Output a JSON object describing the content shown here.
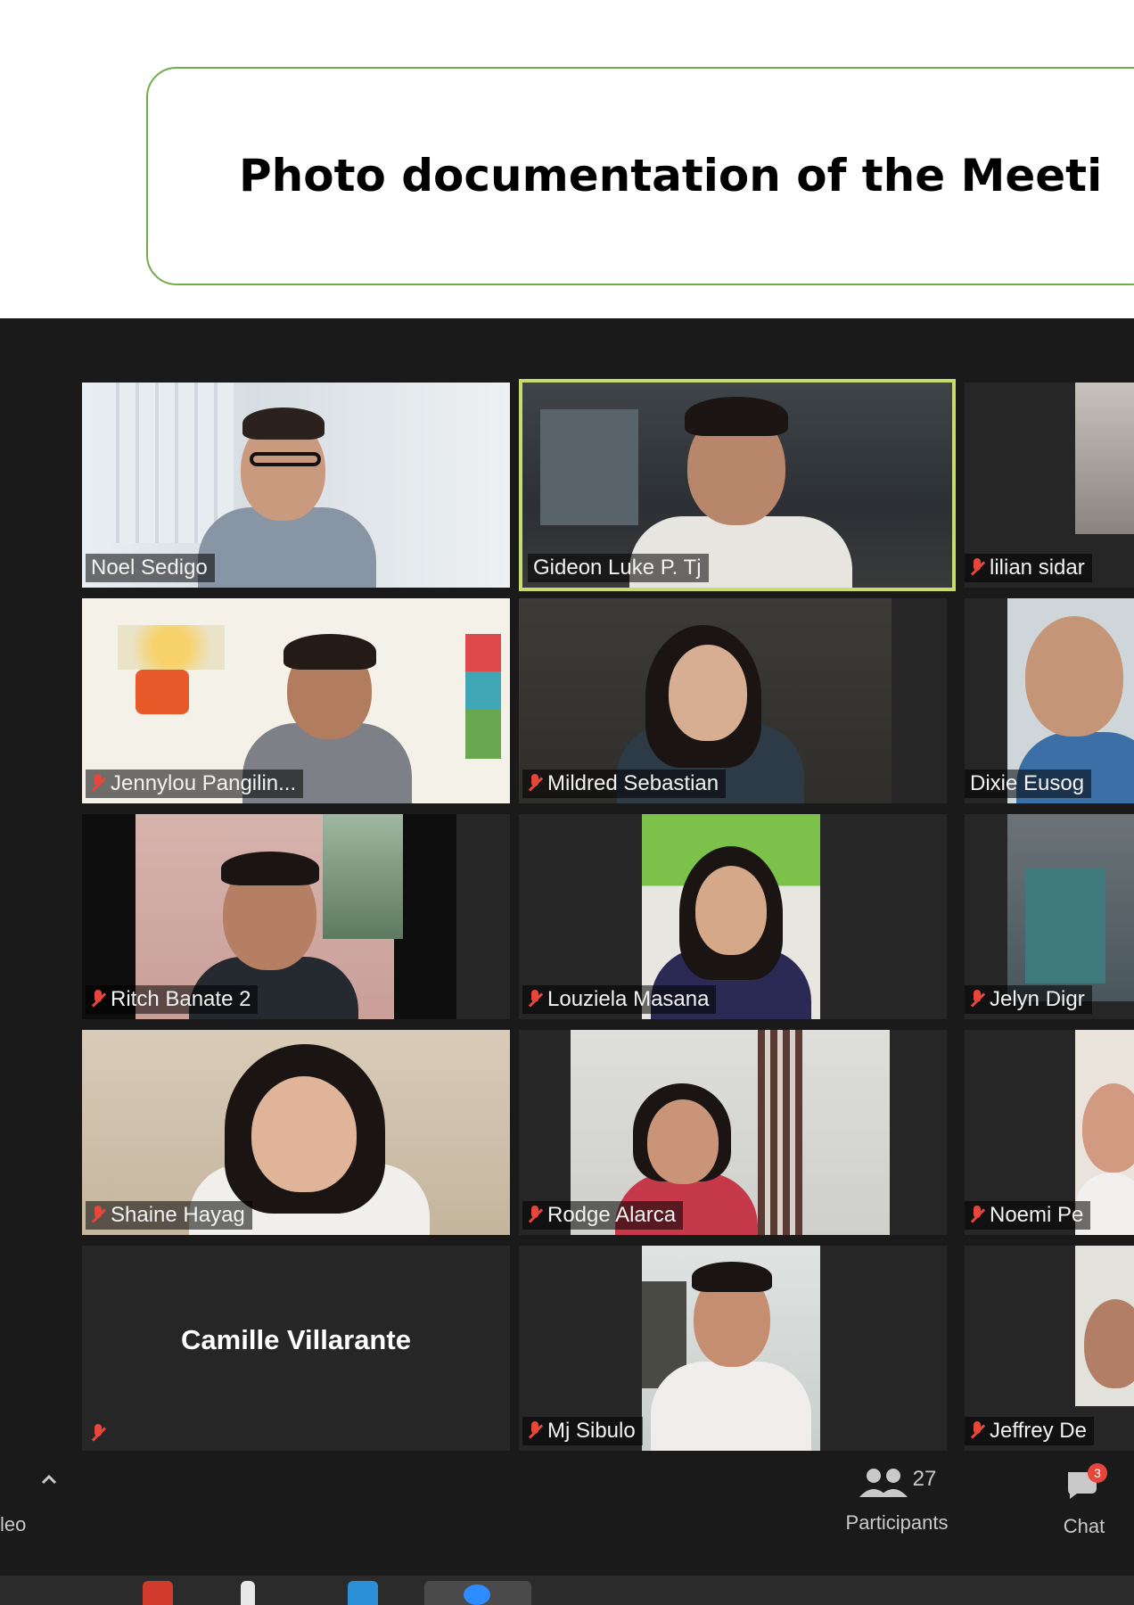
{
  "header": {
    "title": "Photo documentation of the Meeti"
  },
  "participants": [
    {
      "name": "Noel Sedigo",
      "muted": false,
      "active": false
    },
    {
      "name": "Gideon Luke P. Tj",
      "muted": false,
      "active": true
    },
    {
      "name": "lilian sidar",
      "muted": true,
      "active": false
    },
    {
      "name": "Jennylou Pangilin...",
      "muted": true,
      "active": false
    },
    {
      "name": "Mildred Sebastian",
      "muted": true,
      "active": false
    },
    {
      "name": "Dixie Eusog",
      "muted": false,
      "active": false
    },
    {
      "name": "Ritch Banate 2",
      "muted": true,
      "active": false
    },
    {
      "name": "Louziela Masana",
      "muted": true,
      "active": false
    },
    {
      "name": "Jelyn Digr",
      "muted": true,
      "active": false
    },
    {
      "name": "Shaine Hayag",
      "muted": true,
      "active": false
    },
    {
      "name": "Rodge Alarca",
      "muted": true,
      "active": false
    },
    {
      "name": "Noemi Pe",
      "muted": true,
      "active": false
    },
    {
      "name": "Camille Villarante",
      "muted": true,
      "active": false,
      "video_off": true
    },
    {
      "name": "Mj Sibulo",
      "muted": true,
      "active": false
    },
    {
      "name": "Jeffrey De",
      "muted": true,
      "active": false
    }
  ],
  "toolbar": {
    "video_label": "leo",
    "participants_label": "Participants",
    "participants_count": "27",
    "chat_label": "Chat",
    "chat_badge": "3"
  },
  "colors": {
    "accent_border": "#70ad47",
    "active_speaker": "#c8dc6e",
    "muted_icon": "#e8463a",
    "window_bg": "#1a1a1a"
  }
}
